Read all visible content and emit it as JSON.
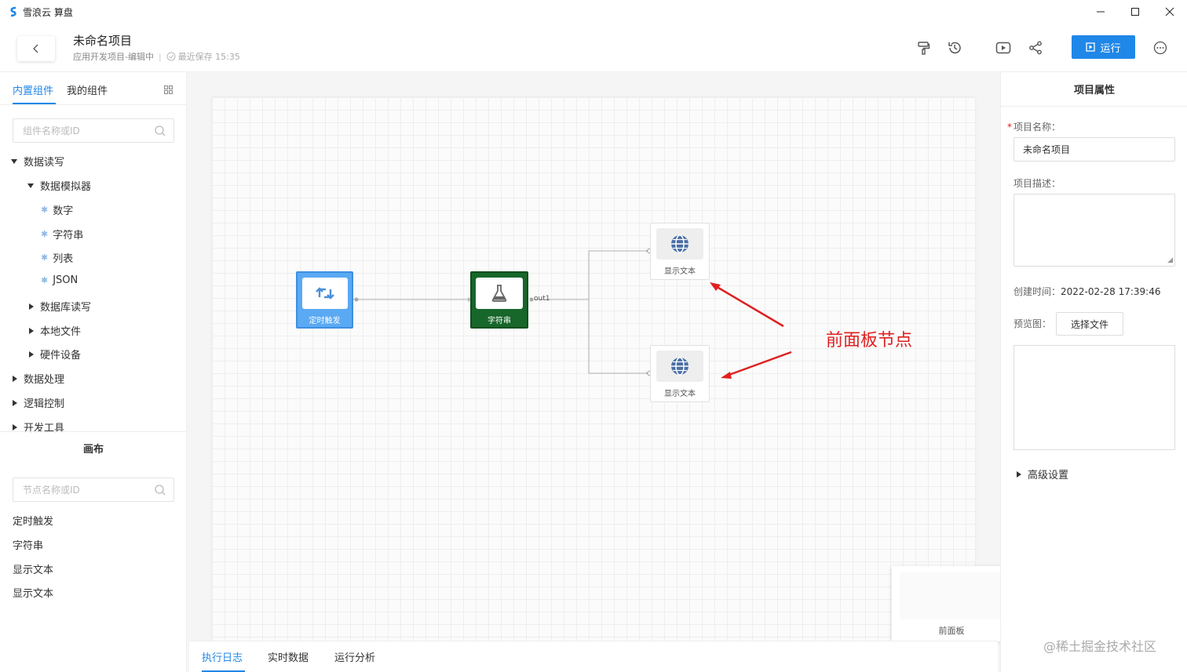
{
  "app": {
    "title": "雪浪云 算盘"
  },
  "header": {
    "project_title": "未命名项目",
    "project_subtitle": "应用开发项目-编辑中",
    "saved_text": "最近保存 15:35",
    "run_label": "运行"
  },
  "left": {
    "tabs": [
      "内置组件",
      "我的组件"
    ],
    "component_search_placeholder": "组件名称或ID",
    "tree": {
      "data_rw": "数据读写",
      "simulator": "数据模拟器",
      "sim_items": [
        "数字",
        "字符串",
        "列表",
        "JSON"
      ],
      "db_rw": "数据库读写",
      "local_file": "本地文件",
      "hardware": "硬件设备",
      "data_proc": "数据处理",
      "logic": "逻辑控制",
      "devtools": "开发工具"
    },
    "canvas_title": "画布",
    "node_search_placeholder": "节点名称或ID",
    "nodes": [
      "定时触发",
      "字符串",
      "显示文本",
      "显示文本"
    ]
  },
  "canvas": {
    "node_timer": "定时触发",
    "node_string": "字符串",
    "node_display1": "显示文本",
    "node_display2": "显示文本",
    "port_out": "out1",
    "annotation": "前面板节点",
    "minimap_label": "前面板",
    "colors": {
      "timer": "#5aa9f3",
      "string": "#17662a",
      "arrow": "#e02020"
    }
  },
  "bottom_tabs": [
    "执行日志",
    "实时数据",
    "运行分析"
  ],
  "right": {
    "title": "项目属性",
    "name_label": "项目名称：",
    "name_value": "未命名项目",
    "desc_label": "项目描述：",
    "created_label": "创建时间：",
    "created_value": "2022-02-28 17:39:46",
    "preview_label": "预览图：",
    "select_file": "选择文件",
    "advanced": "高级设置"
  },
  "watermark": "@稀土掘金技术社区"
}
